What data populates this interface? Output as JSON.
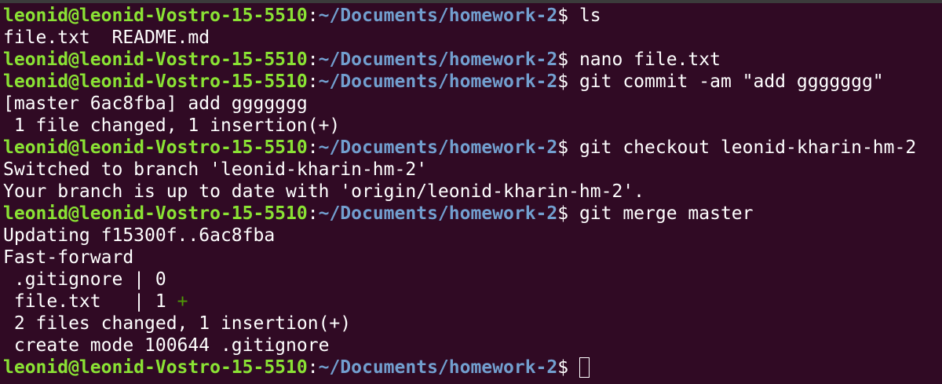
{
  "prompt": {
    "user_host": "leonid@leonid-Vostro-15-5510",
    "colon": ":",
    "path": "~/Documents/homework-2",
    "dollar": "$ "
  },
  "lines": [
    {
      "type": "prompt",
      "command": "ls"
    },
    {
      "type": "output",
      "text": "file.txt  README.md"
    },
    {
      "type": "prompt",
      "command": "nano file.txt"
    },
    {
      "type": "prompt",
      "command": "git commit -am \"add ggggggg\""
    },
    {
      "type": "output",
      "text": "[master 6ac8fba] add ggggggg"
    },
    {
      "type": "output",
      "text": " 1 file changed, 1 insertion(+)"
    },
    {
      "type": "prompt",
      "command": "git checkout leonid-kharin-hm-2"
    },
    {
      "type": "output",
      "text": "Switched to branch 'leonid-kharin-hm-2'"
    },
    {
      "type": "output",
      "text": "Your branch is up to date with 'origin/leonid-kharin-hm-2'."
    },
    {
      "type": "prompt",
      "command": "git merge master"
    },
    {
      "type": "output",
      "text": "Updating f15300f..6ac8fba"
    },
    {
      "type": "output",
      "text": "Fast-forward"
    },
    {
      "type": "output",
      "text": " .gitignore | 0"
    },
    {
      "type": "diffstat",
      "text": " file.txt   | 1 ",
      "plus": "+"
    },
    {
      "type": "output",
      "text": " 2 files changed, 1 insertion(+)"
    },
    {
      "type": "output",
      "text": " create mode 100644 .gitignore"
    },
    {
      "type": "prompt",
      "command": "",
      "cursor": true
    }
  ],
  "colors": {
    "background": "#300a24",
    "user_host": "#8ae234",
    "path": "#729fcf",
    "text": "#ffffff",
    "diff_plus": "#4e9a06"
  }
}
